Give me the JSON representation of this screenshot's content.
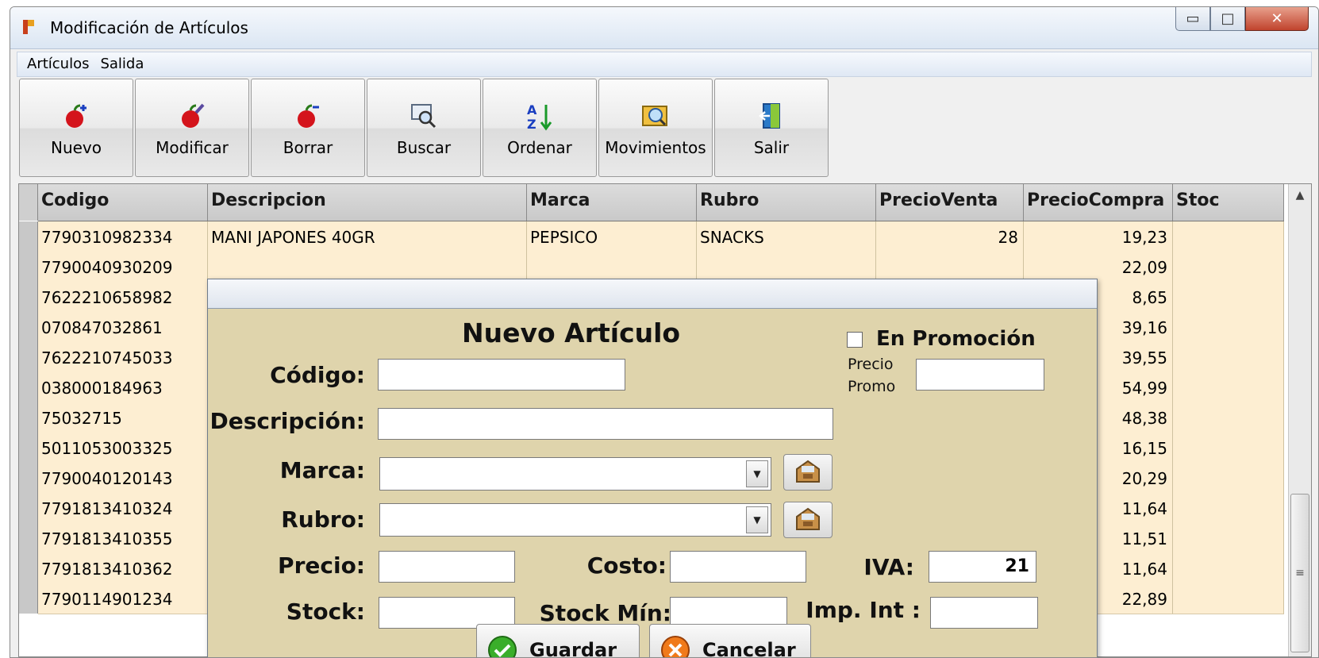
{
  "window": {
    "title": "Modificación de Artículos"
  },
  "menu": [
    "Artículos",
    "Salida"
  ],
  "toolbar": [
    {
      "label": "Nuevo",
      "icon": "apple-add-icon"
    },
    {
      "label": "Modificar",
      "icon": "apple-edit-icon"
    },
    {
      "label": "Borrar",
      "icon": "apple-remove-icon"
    },
    {
      "label": "Buscar",
      "icon": "search-icon"
    },
    {
      "label": "Ordenar",
      "icon": "sort-az-icon"
    },
    {
      "label": "Movimientos",
      "icon": "movements-icon"
    },
    {
      "label": "Salir",
      "icon": "exit-door-icon"
    }
  ],
  "grid": {
    "columns": [
      "Codigo",
      "Descripcion",
      "Marca",
      "Rubro",
      "PrecioVenta",
      "PrecioCompra",
      "Stoc"
    ],
    "rows": [
      [
        "7790310982334",
        "MANI JAPONES 40GR",
        "PEPSICO",
        "SNACKS",
        "28",
        "19,23",
        ""
      ],
      [
        "7790040930209",
        "",
        "",
        "",
        "",
        "22,09",
        ""
      ],
      [
        "7622210658982",
        "",
        "",
        "",
        "",
        "8,65",
        ""
      ],
      [
        "070847032861",
        "",
        "",
        "",
        "",
        "39,16",
        ""
      ],
      [
        "7622210745033",
        "",
        "",
        "",
        "",
        "39,55",
        ""
      ],
      [
        "038000184963",
        "",
        "",
        "",
        "",
        "54,99",
        ""
      ],
      [
        "75032715",
        "",
        "",
        "",
        "",
        "48,38",
        ""
      ],
      [
        "5011053003325",
        "",
        "",
        "",
        "",
        "16,15",
        ""
      ],
      [
        "7790040120143",
        "",
        "",
        "",
        "",
        "20,29",
        ""
      ],
      [
        "7791813410324",
        "",
        "",
        "",
        "",
        "11,64",
        ""
      ],
      [
        "7791813410355",
        "",
        "",
        "",
        "",
        "11,51",
        ""
      ],
      [
        "7791813410362",
        "",
        "",
        "",
        "",
        "11,64",
        ""
      ],
      [
        "7790114901234",
        "",
        "",
        "",
        "",
        "22,89",
        ""
      ]
    ]
  },
  "dialog": {
    "heading": "Nuevo Artículo",
    "promo_label": "En Promoción",
    "promo_price_label_1": "Precio",
    "promo_price_label_2": "Promo",
    "codigo_label": "Código:",
    "descripcion_label": "Descripción:",
    "marca_label": "Marca:",
    "rubro_label": "Rubro:",
    "precio_label": "Precio:",
    "costo_label": "Costo:",
    "iva_label": "IVA:",
    "iva_value": "21",
    "stock_label": "Stock:",
    "stock_min_label": "Stock Mín:",
    "imp_int_label": "Imp. Int :",
    "guardar_label": "Guardar",
    "cancelar_label": "Cancelar"
  }
}
